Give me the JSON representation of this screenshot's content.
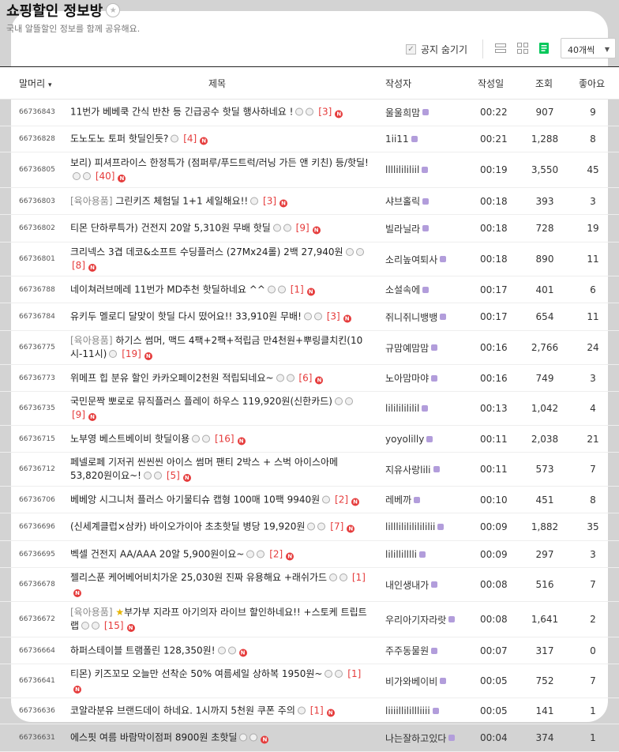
{
  "board": {
    "title": "쇼핑할인 정보방",
    "description": "국내 알뜰할인 정보를 함께 공유해요.",
    "star_glyph": "★"
  },
  "toolbar": {
    "hide_notice_label": "공지 숨기기",
    "check_glyph": "✓",
    "page_size": "40개씩",
    "caret": "▼"
  },
  "columns": {
    "prefix": "말머리",
    "prefix_caret": "▾",
    "title": "제목",
    "author": "작성자",
    "date": "작성일",
    "views": "조회",
    "likes": "좋아요"
  },
  "posts": [
    {
      "id": "66736843",
      "title": "11번가 베베쿡 간식 반찬 등 긴급공수 핫딜 행사하네요 !",
      "tag": "",
      "icons": 2,
      "comments": "[3]",
      "author": "울울희맘",
      "time": "00:22",
      "views": "907",
      "likes": "9"
    },
    {
      "id": "66736828",
      "title": "도노도노 토퍼 핫딜인듯?",
      "tag": "",
      "icons": 1,
      "comments": "[4]",
      "author": "1ii11",
      "time": "00:21",
      "views": "1,288",
      "likes": "8"
    },
    {
      "id": "66736805",
      "title": "보리) 피셔프라이스 한정특가 (점퍼루/푸드트럭/러닝 가든 앤 키친) 등/핫딜!",
      "tag": "",
      "icons": 2,
      "comments": "[40]",
      "author": "llllilililiil",
      "time": "00:19",
      "views": "3,550",
      "likes": "45"
    },
    {
      "id": "66736803",
      "title": "그린키즈 체험딜 1+1 세일해요!!",
      "tag": "[육아용품]",
      "icons": 1,
      "comments": "[3]",
      "author": "샤브홀릭",
      "time": "00:18",
      "views": "393",
      "likes": "3"
    },
    {
      "id": "66736802",
      "title": "티몬 단하루특가) 건전지 20알 5,310원 무배 핫딜",
      "tag": "",
      "icons": 2,
      "comments": "[9]",
      "author": "빌라닐라",
      "time": "00:18",
      "views": "728",
      "likes": "19"
    },
    {
      "id": "66736801",
      "title": "크리넥스 3겹 데코&소프트 수딩플러스 (27Mx24롤) 2백 27,940원",
      "tag": "",
      "icons": 2,
      "comments": "[8]",
      "author": "소리높여퇴사",
      "time": "00:18",
      "views": "890",
      "likes": "11"
    },
    {
      "id": "66736788",
      "title": "네이쳐러브메레 11번가 MD추천 핫딜하네요 ^^",
      "tag": "",
      "icons": 2,
      "comments": "[1]",
      "author": "소설속에",
      "time": "00:17",
      "views": "401",
      "likes": "6"
    },
    {
      "id": "66736784",
      "title": "유키두 멜로디 달맞이 핫딜 다시 떴어요!! 33,910원 무배!",
      "tag": "",
      "icons": 2,
      "comments": "[3]",
      "author": "쥐니쥐니뱅뱅",
      "time": "00:17",
      "views": "654",
      "likes": "11"
    },
    {
      "id": "66736775",
      "title": "하기스 썸머, 맥드 4팩+2팩+적립금 만4천원+뿌링클치킨(10시-11시)",
      "tag": "[육아용품]",
      "icons": 1,
      "comments": "[19]",
      "author": "규맘예맘맘",
      "time": "00:16",
      "views": "2,766",
      "likes": "24"
    },
    {
      "id": "66736773",
      "title": "위메프 힙 분유 할인 카카오페이2천원 적립되네요~",
      "tag": "",
      "icons": 2,
      "comments": "[6]",
      "author": "노아맘마야",
      "time": "00:16",
      "views": "749",
      "likes": "3"
    },
    {
      "id": "66736735",
      "title": "국민문짝 뽀로로 뮤직플러스 플레이 하우스 119,920원(신한카드)",
      "tag": "",
      "icons": 2,
      "comments": "[9]",
      "author": "lilililililil",
      "time": "00:13",
      "views": "1,042",
      "likes": "4"
    },
    {
      "id": "66736715",
      "title": "노부영 베스트베이비 핫딜이용",
      "tag": "",
      "icons": 2,
      "comments": "[16]",
      "author": "yoyolilly",
      "time": "00:11",
      "views": "2,038",
      "likes": "21"
    },
    {
      "id": "66736712",
      "title": "페넬로페 기저귀 씬씬씬 아이스 썸머 팬티 2박스 + 스벅 아이스아메 53,820원이요~!",
      "tag": "",
      "icons": 2,
      "comments": "[5]",
      "author": "지유사랑lili",
      "time": "00:11",
      "views": "573",
      "likes": "7"
    },
    {
      "id": "66736706",
      "title": "베베앙 시그니처 플러스 아기물티슈 캡형 100매 10팩 9940원",
      "tag": "",
      "icons": 1,
      "comments": "[2]",
      "author": "레베까",
      "time": "00:10",
      "views": "451",
      "likes": "8"
    },
    {
      "id": "66736696",
      "title": "(신세계클럽×삼카) 바이오가이아 초초핫딜 병당 19,920원",
      "tag": "",
      "icons": 2,
      "comments": "[7]",
      "author": "lilllililililililii",
      "time": "00:09",
      "views": "1,882",
      "likes": "35"
    },
    {
      "id": "66736695",
      "title": "벡셀 건전지 AA/AAA 20알 5,900원이요~",
      "tag": "",
      "icons": 2,
      "comments": "[2]",
      "author": "lilillilllli",
      "time": "00:09",
      "views": "297",
      "likes": "3"
    },
    {
      "id": "66736678",
      "title": "젤리스푼 케어베어비치가운 25,030원 진짜 유용해요 +래쉬가드",
      "tag": "",
      "icons": 2,
      "comments": "[1]",
      "author": "내인생내가",
      "time": "00:08",
      "views": "516",
      "likes": "7"
    },
    {
      "id": "66736672",
      "title": "부가부 지라프 아기의자 라이브 할인하네요!! +스토케 트립트랩",
      "tag": "[육아용품]",
      "star": "★",
      "icons": 2,
      "comments": "[15]",
      "author": "우리아기자라랏",
      "time": "00:08",
      "views": "1,641",
      "likes": "2"
    },
    {
      "id": "66736664",
      "title": "하퍼스테이블 트램폴린 128,350원!",
      "tag": "",
      "icons": 2,
      "comments": "",
      "author": "주주동물원",
      "time": "00:07",
      "views": "317",
      "likes": "0"
    },
    {
      "id": "66736641",
      "title": "티몬) 키즈꼬모 오늘만 선착순 50% 여름세일 상하복 1950원~",
      "tag": "",
      "icons": 2,
      "comments": "[1]",
      "author": "비가와베이비",
      "time": "00:05",
      "views": "752",
      "likes": "7"
    },
    {
      "id": "66736636",
      "title": "코알라분유 브랜드데이 하네요. 1시까지 5천원 쿠폰 주의",
      "tag": "",
      "icons": 1,
      "comments": "[1]",
      "author": "liiiillilillliiii",
      "time": "00:05",
      "views": "141",
      "likes": "1"
    },
    {
      "id": "66736631",
      "title": "에스핏 여름 바람막이점퍼 8900원 초핫딜",
      "tag": "",
      "icons": 2,
      "comments": "",
      "author": "나는잘하고있다",
      "time": "00:04",
      "views": "374",
      "likes": "1"
    }
  ]
}
